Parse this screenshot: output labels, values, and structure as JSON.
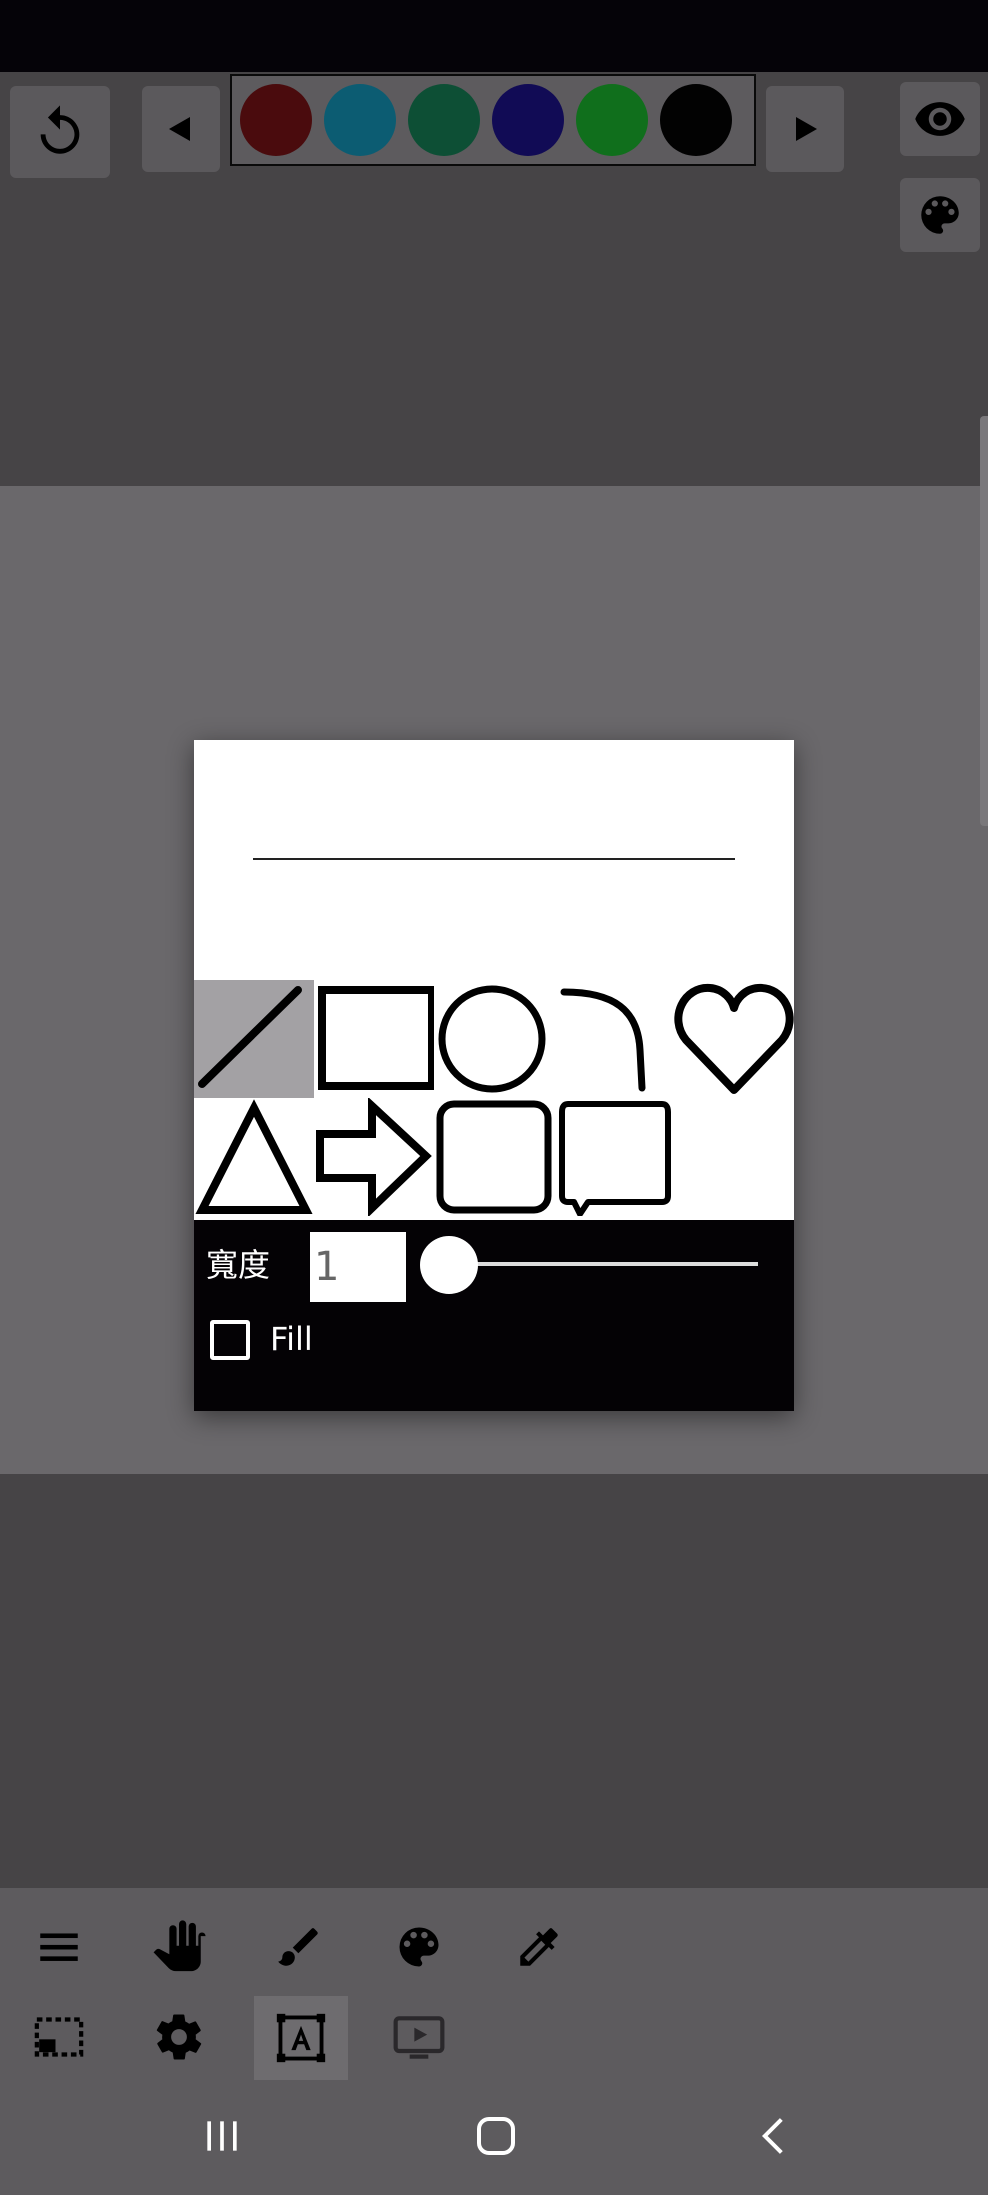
{
  "top_toolbar": {
    "icons": [
      "undo-icon",
      "prev-arrow-icon",
      "next-arrow-icon",
      "eye-icon",
      "palette-icon"
    ],
    "colors": [
      "#4a0b0d",
      "#0c5c72",
      "#0d4f35",
      "#110b55",
      "#106f1c",
      "#020202"
    ]
  },
  "dialog": {
    "shapes": [
      "line",
      "rectangle",
      "circle",
      "curve",
      "heart",
      "triangle",
      "arrow",
      "rounded-square",
      "speech-bubble"
    ],
    "selected_shape": "line",
    "width_label": "寬度",
    "width_value": "1",
    "fill_label": "Fill",
    "fill_checked": false
  },
  "bottom_toolbar": {
    "icons": [
      "menu-icon",
      "hand-icon",
      "brush-icon",
      "palette-icon",
      "eyedropper-icon",
      "selection-icon",
      "settings-icon",
      "text-box-icon",
      "preview-icon"
    ],
    "active": "text-box-icon"
  },
  "nav_bar": {
    "icons": [
      "recent-apps-icon",
      "home-icon",
      "back-icon"
    ]
  }
}
